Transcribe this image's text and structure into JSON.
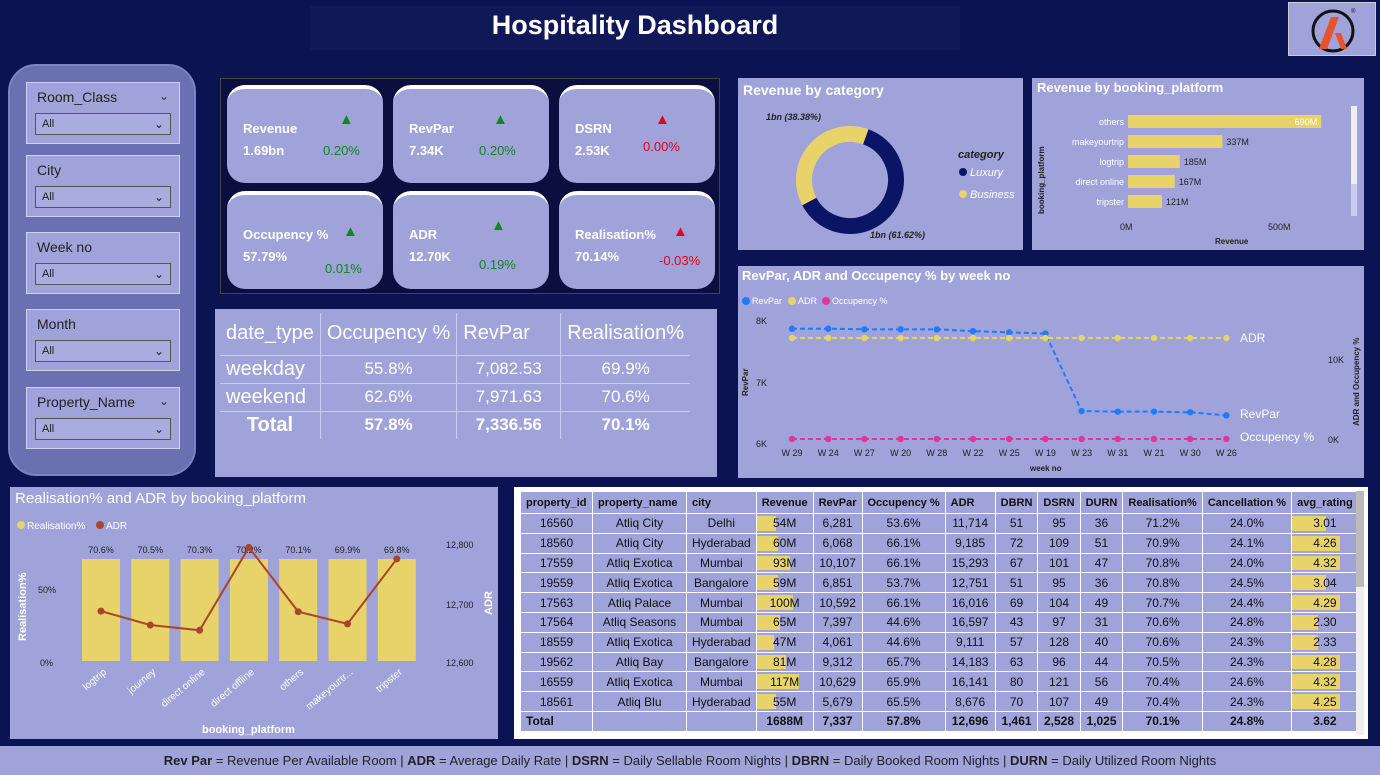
{
  "title": "Hospitality Dashboard",
  "slicers": [
    {
      "label": "Room_Class",
      "value": "All"
    },
    {
      "label": "City",
      "value": "All"
    },
    {
      "label": "Week no",
      "value": "All"
    },
    {
      "label": "Month",
      "value": "All"
    },
    {
      "label": "Property_Name",
      "value": "All"
    }
  ],
  "kpis": [
    {
      "name": "Revenue",
      "value": "1.69bn",
      "change": "0.20%",
      "trend": "up"
    },
    {
      "name": "RevPar",
      "value": "7.34K",
      "change": "0.20%",
      "trend": "up"
    },
    {
      "name": "DSRN",
      "value": "2.53K",
      "change": "0.00%",
      "trend": "down"
    },
    {
      "name": "Occupency %",
      "value": "57.79%",
      "change": "0.01%",
      "trend": "up"
    },
    {
      "name": "ADR",
      "value": "12.70K",
      "change": "0.19%",
      "trend": "up"
    },
    {
      "name": "Realisation%",
      "value": "70.14%",
      "change": "-0.03%",
      "trend": "down"
    }
  ],
  "date_table": {
    "headers": [
      "date_type",
      "Occupency %",
      "RevPar",
      "Realisation%"
    ],
    "rows": [
      [
        "weekday",
        "55.8%",
        "7,082.53",
        "69.9%"
      ],
      [
        "weekend",
        "62.6%",
        "7,971.63",
        "70.6%"
      ]
    ],
    "total": [
      "Total",
      "57.8%",
      "7,336.56",
      "70.1%"
    ]
  },
  "revenue_category": {
    "title": "Revenue by category",
    "legend_title": "category",
    "legend": [
      "Luxury",
      "Business"
    ],
    "labels": [
      "1bn (38.38%)",
      "1bn (61.62%)"
    ]
  },
  "booking_chart": {
    "title": "Revenue by booking_platform",
    "ylabel": "booking_platform",
    "xlabel": "Revenue",
    "ticks": [
      "0M",
      "500M"
    ]
  },
  "week_chart": {
    "title": "RevPar, ADR and Occupency % by week no",
    "legend": [
      "RevPar",
      "ADR",
      "Occupency %"
    ],
    "xlabel": "week no",
    "ylabel_left": "RevPar",
    "ylabel_right": "ADR and Occupency %",
    "yticks_left": [
      "8K",
      "7K",
      "6K"
    ],
    "yticks_right": [
      "10K",
      "0K"
    ],
    "line_labels": [
      "ADR",
      "RevPar",
      "Occupency %"
    ]
  },
  "real_chart": {
    "title": "Realisation% and ADR by booking_platform",
    "legend": [
      "Realisation%",
      "ADR"
    ],
    "xlabel": "booking_platform",
    "ylabel_left": "Realisation%",
    "ylabel_right": "ADR",
    "yticks_left": [
      "50%",
      "0%"
    ],
    "yticks_right": [
      "12,800",
      "12,700",
      "12,600"
    ]
  },
  "property_table": {
    "headers": [
      "property_id",
      "property_name",
      "city",
      "Revenue",
      "RevPar",
      "Occupency %",
      "ADR",
      "DBRN",
      "DSRN",
      "DURN",
      "Realisation%",
      "Cancellation %",
      "avg_rating"
    ],
    "rows": [
      [
        "16560",
        "Atliq City",
        "Delhi",
        "54M",
        "6,281",
        "53.6%",
        "11,714",
        "51",
        "95",
        "36",
        "71.2%",
        "24.0%",
        "3.01"
      ],
      [
        "18560",
        "Atliq City",
        "Hyderabad",
        "60M",
        "6,068",
        "66.1%",
        "9,185",
        "72",
        "109",
        "51",
        "70.9%",
        "24.1%",
        "4.26"
      ],
      [
        "17559",
        "Atliq Exotica",
        "Mumbai",
        "93M",
        "10,107",
        "66.1%",
        "15,293",
        "67",
        "101",
        "47",
        "70.8%",
        "24.0%",
        "4.32"
      ],
      [
        "19559",
        "Atliq Exotica",
        "Bangalore",
        "59M",
        "6,851",
        "53.7%",
        "12,751",
        "51",
        "95",
        "36",
        "70.8%",
        "24.5%",
        "3.04"
      ],
      [
        "17563",
        "Atliq Palace",
        "Mumbai",
        "100M",
        "10,592",
        "66.1%",
        "16,016",
        "69",
        "104",
        "49",
        "70.7%",
        "24.4%",
        "4.29"
      ],
      [
        "17564",
        "Atliq Seasons",
        "Mumbai",
        "65M",
        "7,397",
        "44.6%",
        "16,597",
        "43",
        "97",
        "31",
        "70.6%",
        "24.8%",
        "2.30"
      ],
      [
        "18559",
        "Atliq Exotica",
        "Hyderabad",
        "47M",
        "4,061",
        "44.6%",
        "9,111",
        "57",
        "128",
        "40",
        "70.6%",
        "24.3%",
        "2.33"
      ],
      [
        "19562",
        "Atliq Bay",
        "Bangalore",
        "81M",
        "9,312",
        "65.7%",
        "14,183",
        "63",
        "96",
        "44",
        "70.5%",
        "24.3%",
        "4.28"
      ],
      [
        "16559",
        "Atliq Exotica",
        "Mumbai",
        "117M",
        "10,629",
        "65.9%",
        "16,141",
        "80",
        "121",
        "56",
        "70.4%",
        "24.6%",
        "4.32"
      ],
      [
        "18561",
        "Atliq Blu",
        "Hyderabad",
        "55M",
        "5,679",
        "65.5%",
        "8,676",
        "70",
        "107",
        "49",
        "70.4%",
        "24.3%",
        "4.25"
      ]
    ],
    "total": [
      "Total",
      "",
      "",
      "1688M",
      "7,337",
      "57.8%",
      "12,696",
      "1,461",
      "2,528",
      "1,025",
      "70.1%",
      "24.8%",
      "3.62"
    ]
  },
  "footer": [
    {
      "b": "Rev Par",
      "t": " = Revenue Per Available Room  |  "
    },
    {
      "b": "ADR",
      "t": " = Average Daily Rate  |  "
    },
    {
      "b": "DSRN",
      "t": " = Daily Sellable Room Nights |  "
    },
    {
      "b": "DBRN",
      "t": " = Daily Booked Room Nights  |  "
    },
    {
      "b": "DURN",
      "t": " = Daily Utilized Room Nights"
    }
  ],
  "colors": {
    "bg": "#0c1353",
    "panel": "#9fa3d9",
    "gold": "#e8d36b",
    "navy": "#0b1566",
    "blue": "#1e7bff",
    "pink": "#e0369b",
    "brown": "#a9462a"
  },
  "chart_data": [
    {
      "type": "pie",
      "title": "Revenue by category",
      "categories": [
        "Luxury",
        "Business"
      ],
      "values": [
        61.62,
        38.38
      ],
      "value_labels": [
        "1bn (61.62%)",
        "1bn (38.38%)"
      ]
    },
    {
      "type": "bar",
      "title": "Revenue by booking_platform",
      "categories": [
        "others",
        "makeyourtrip",
        "logtrip",
        "direct online",
        "tripster"
      ],
      "values": [
        690,
        337,
        185,
        167,
        121
      ],
      "value_labels": [
        "690M",
        "337M",
        "185M",
        "167M",
        "121M"
      ],
      "xlabel": "Revenue",
      "ylabel": "booking_platform",
      "xlim": [
        0,
        800
      ]
    },
    {
      "type": "line",
      "title": "RevPar, ADR and Occupency % by week no",
      "x": [
        "W 29",
        "W 24",
        "W 27",
        "W 20",
        "W 28",
        "W 22",
        "W 25",
        "W 19",
        "W 23",
        "W 31",
        "W 21",
        "W 30",
        "W 26"
      ],
      "series": [
        {
          "name": "RevPar",
          "values": [
            7890,
            7890,
            7880,
            7880,
            7880,
            7850,
            7830,
            7810,
            6540,
            6530,
            6530,
            6520,
            6470
          ]
        },
        {
          "name": "ADR",
          "values": [
            12700,
            12700,
            12700,
            12700,
            12700,
            12700,
            12700,
            12700,
            12700,
            12700,
            12700,
            12700,
            12700
          ]
        },
        {
          "name": "Occupency %",
          "values": [
            57.8,
            57.8,
            57.8,
            57.8,
            57.8,
            57.8,
            57.8,
            57.8,
            57.8,
            57.8,
            57.8,
            57.8,
            57.8
          ]
        }
      ],
      "xlabel": "week no",
      "ylabel": "RevPar",
      "ylim": [
        6000,
        8000
      ]
    },
    {
      "type": "bar",
      "title": "Realisation% and ADR by booking_platform",
      "categories": [
        "logtrip",
        "journey",
        "direct online",
        "direct offline",
        "others",
        "makeyourtr...",
        "tripster"
      ],
      "series": [
        {
          "name": "Realisation%",
          "values": [
            70.6,
            70.5,
            70.3,
            70.2,
            70.1,
            69.9,
            69.8
          ],
          "value_labels": [
            "70.6%",
            "70.5%",
            "70.3%",
            "70.2%",
            "70.1%",
            "69.9%",
            "69.8%"
          ]
        },
        {
          "name": "ADR",
          "values": [
            12686,
            12662,
            12653,
            12796,
            12685,
            12664,
            12776
          ]
        }
      ],
      "xlabel": "booking_platform",
      "ylabel": "Realisation%",
      "ylim": [
        0,
        100
      ],
      "ylim_right": [
        12600,
        12800
      ]
    }
  ]
}
